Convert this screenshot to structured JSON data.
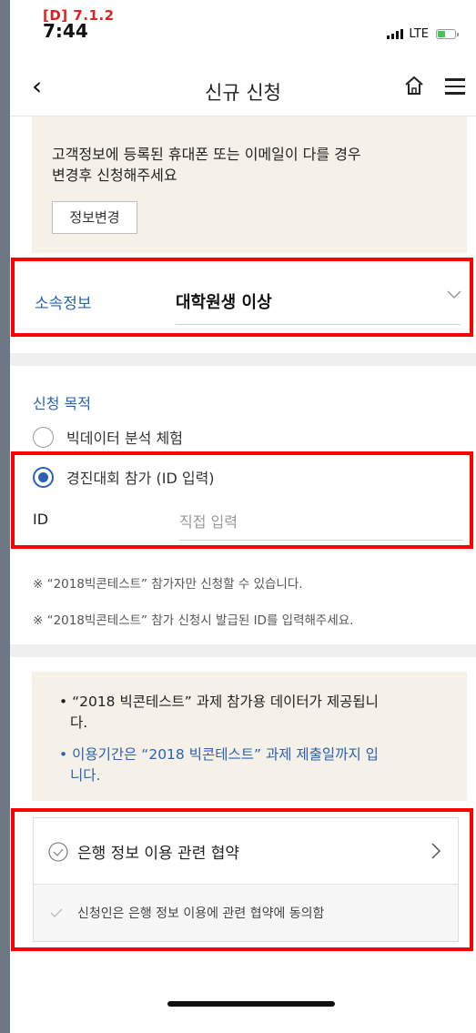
{
  "status": {
    "debug_label": "[D] 7.1.2",
    "time": "7:44",
    "network": "LTE"
  },
  "nav": {
    "back_icon": "back-chevron-icon",
    "title": "신규 신청",
    "home_icon": "home-icon",
    "menu_icon": "menu-icon"
  },
  "notice": {
    "text_line1": "고객정보에 등록된 휴대폰 또는 이메일이 다를 경우",
    "text_line2": "변경후 신청해주세요",
    "button_label": "정보변경"
  },
  "affiliation": {
    "label": "소속정보",
    "value": "대학원생 이상"
  },
  "purpose": {
    "title": "신청 목적",
    "options": [
      {
        "label": "빅데이터 분석 체험",
        "selected": false
      },
      {
        "label": "경진대회 참가 (ID 입력)",
        "selected": true
      }
    ],
    "id_label": "ID",
    "id_placeholder": "직접 입력",
    "id_value": ""
  },
  "notes": [
    "※ “2018빅콘테스트” 참가자만 신청할 수 있습니다.",
    "※ “2018빅콘테스트” 참가 신청시 발급된 ID를 입력해주세요."
  ],
  "info": {
    "item1_line1": "• “2018 빅콘테스트” 과제 참가용 데이터가 제공됩니",
    "item1_line2": "다.",
    "item2_line1": "• 이용기간은 “2018 빅콘테스트” 과제 제출일까지 입",
    "item2_line2": "니다."
  },
  "terms": {
    "title": "은행 정보 이용 관련 협약",
    "agreement": "신청인은 은행 정보 이용에 관련 협약에 동의함"
  },
  "colors": {
    "accent_blue": "#2a62b5",
    "highlight_red": "#ff0000",
    "beige": "#f5f0e8"
  }
}
